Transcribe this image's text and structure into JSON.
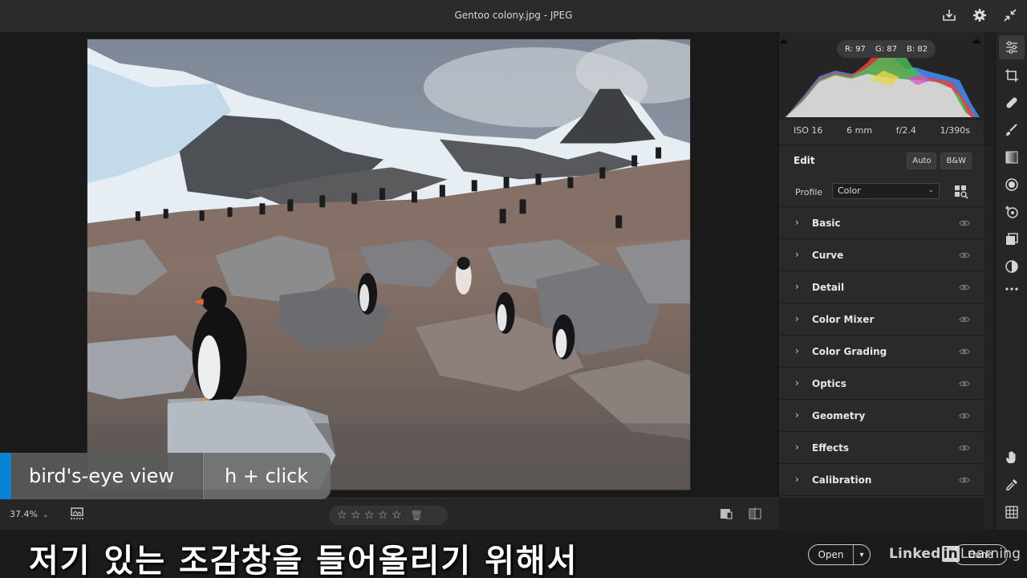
{
  "window": {
    "title": "Gentoo colony.jpg  -  JPEG"
  },
  "title_icons": [
    "download-icon",
    "gear-icon",
    "collapse-icon"
  ],
  "histogram": {
    "r_label": "R: 97",
    "g_label": "G: 87",
    "b_label": "B: 82"
  },
  "exif": {
    "iso": "ISO 16",
    "focal": "6 mm",
    "aperture": "f/2.4",
    "shutter": "1/390s"
  },
  "edit": {
    "title": "Edit",
    "auto_label": "Auto",
    "bw_label": "B&W",
    "profile_label": "Profile",
    "profile_value": "Color"
  },
  "sections": [
    {
      "label": "Basic"
    },
    {
      "label": "Curve"
    },
    {
      "label": "Detail"
    },
    {
      "label": "Color Mixer"
    },
    {
      "label": "Color Grading"
    },
    {
      "label": "Optics"
    },
    {
      "label": "Geometry"
    },
    {
      "label": "Effects"
    },
    {
      "label": "Calibration"
    }
  ],
  "bottombar": {
    "zoom": "37.4%",
    "stars": "☆ ☆ ☆ ☆ ☆",
    "trash": "🗑"
  },
  "footer": {
    "open_label": "Open",
    "open_caret": "▾",
    "done_label": "Done",
    "brand_linked": "Linked",
    "brand_in": "in",
    "brand_learning": "Learning"
  },
  "overlay": {
    "shortcut_name": "bird's-eye view",
    "shortcut_keys": "h + click"
  },
  "subtitle": "저기 있는 조감창을 들어올리기 위해서",
  "colors": {
    "accent": "#0a84d2",
    "panel_bg": "#2a2a2a",
    "app_bg": "#1f1f1f"
  }
}
